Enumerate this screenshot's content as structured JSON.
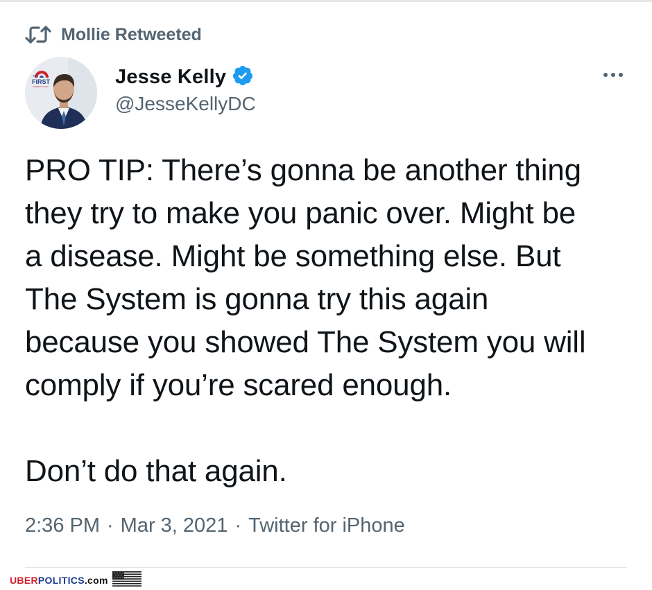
{
  "retweet": {
    "label": "Mollie Retweeted",
    "icon": "retweet-icon"
  },
  "author": {
    "name": "Jesse Kelly",
    "handle": "@JesseKellyDC",
    "verified": true,
    "verified_icon": "verified-badge-icon",
    "avatar_logo_text": "FIRST",
    "avatar_logo_small": "THE",
    "avatar_logo_sub": "THEFIRSTTV.COM"
  },
  "more_menu": {
    "icon": "more-options-icon"
  },
  "tweet": {
    "paragraphs": [
      "PRO TIP: There’s gonna be another thing\nthey try to make you panic over. Might be\na disease. Might be something else. But\nThe System is gonna try this again\nbecause you showed The System you will\ncomply if you’re scared enough.",
      "Don’t do that again."
    ],
    "time": "2:36 PM",
    "separator": "·",
    "date": "Mar 3, 2021",
    "source": "Twitter for iPhone"
  },
  "watermark": {
    "part1": "UBER",
    "part2": "POLITICS",
    "part3": ".com",
    "flag_icon": "us-flag-icon"
  },
  "colors": {
    "text_primary": "#0f1419",
    "text_secondary": "#536471",
    "verified_blue": "#1d9bf0",
    "watermark_red": "#d0202a",
    "watermark_blue": "#1d3b8f"
  }
}
